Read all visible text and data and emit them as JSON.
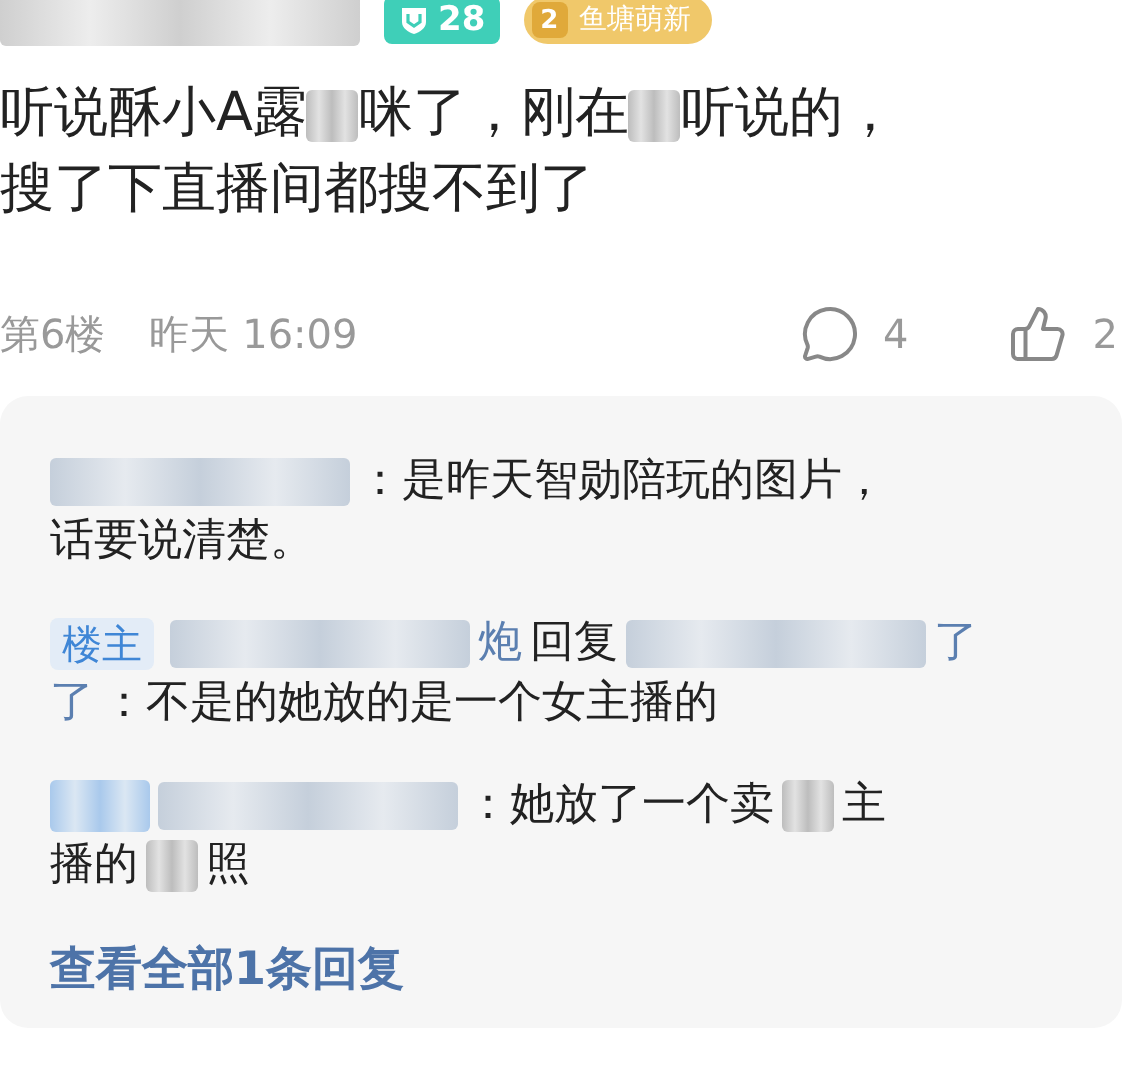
{
  "author": {
    "badges": [
      {
        "kind": "fans",
        "text": "28"
      },
      {
        "kind": "level",
        "level_text": "2",
        "text": "鱼塘萌新"
      }
    ]
  },
  "post": {
    "lines": [
      [
        {
          "kind": "text",
          "text": "听说酥小A露"
        },
        {
          "kind": "blur"
        },
        {
          "kind": "text",
          "text": "咪了，刚在"
        },
        {
          "kind": "blur"
        },
        {
          "kind": "text",
          "text": "听说的，"
        }
      ],
      [
        {
          "kind": "text",
          "text": "搜了下直播间都搜不到了"
        }
      ]
    ]
  },
  "meta": {
    "floor": "第6楼",
    "time": "昨天 16:09",
    "comments": "4",
    "likes": "2"
  },
  "replies": [
    [
      [
        {
          "kind": "name_blur"
        },
        {
          "kind": "text",
          "text": "：是昨天智勋陪玩的图片，"
        }
      ],
      [
        {
          "kind": "text",
          "text": "话要说清楚。"
        }
      ]
    ],
    [
      [
        {
          "kind": "op_badge",
          "text": "楼主"
        },
        {
          "kind": "name_blur"
        },
        {
          "kind": "name",
          "text": "炮"
        },
        {
          "kind": "text",
          "text": "回复"
        },
        {
          "kind": "name_blur"
        },
        {
          "kind": "name",
          "text": "了"
        }
      ],
      [
        {
          "kind": "name",
          "text": "了"
        },
        {
          "kind": "text",
          "text": "：不是的她放的是一个女主播的"
        }
      ]
    ],
    [
      [
        {
          "kind": "badge_blur"
        },
        {
          "kind": "name_blur"
        },
        {
          "kind": "text",
          "text": "：她放了一个卖"
        },
        {
          "kind": "blur"
        },
        {
          "kind": "text",
          "text": "主"
        }
      ],
      [
        {
          "kind": "text",
          "text": "播的"
        },
        {
          "kind": "blur"
        },
        {
          "kind": "text",
          "text": "照"
        }
      ]
    ]
  ],
  "more_link": "查看全部1条回复"
}
